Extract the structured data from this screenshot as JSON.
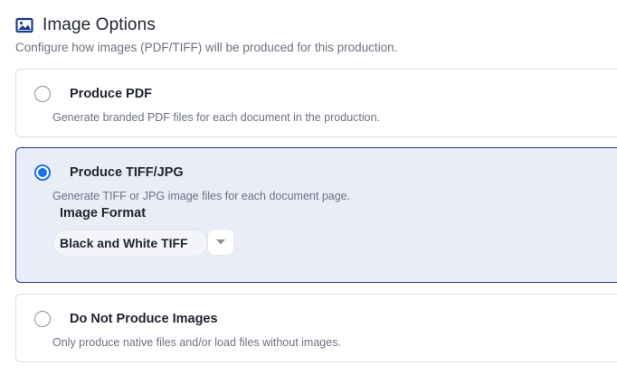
{
  "header": {
    "title": "Image Options",
    "subtitle": "Configure how images (PDF/TIFF) will be produced for this production.",
    "icon": "image-icon",
    "icon_color": "#1e3a8a"
  },
  "options": [
    {
      "label": "Produce PDF",
      "description": "Generate branded PDF files for each document in the production.",
      "selected": false
    },
    {
      "label": "Produce TIFF/JPG",
      "description": "Generate TIFF or JPG image files for each document page.",
      "selected": true,
      "format_label": "Image Format",
      "format_value": "Black and White TIFF"
    },
    {
      "label": "Do Not Produce Images",
      "description": "Only produce native files and/or load files without images.",
      "selected": false
    }
  ],
  "colors": {
    "accent": "#1a73e8",
    "selected_border": "#1e3a8a",
    "selected_bg": "#e8edf7"
  }
}
